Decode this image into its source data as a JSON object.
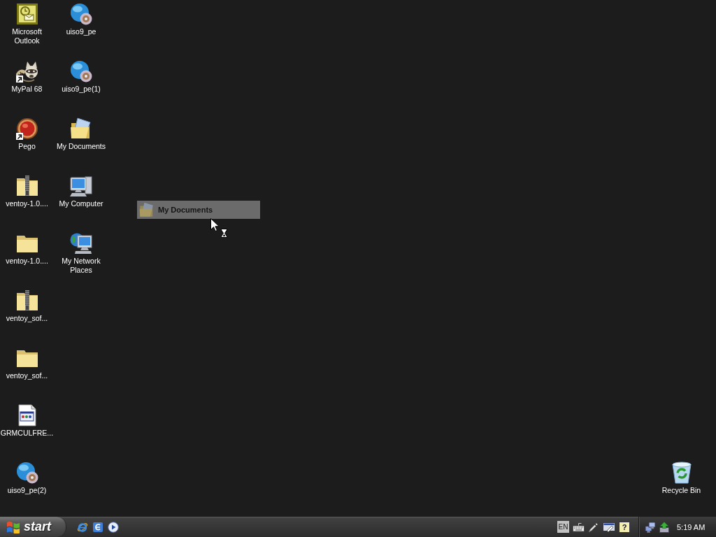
{
  "desktop": {
    "icons": [
      {
        "label": "Microsoft Outlook",
        "kind": "mail-app",
        "shortcut": false
      },
      {
        "label": "MyPal 68",
        "kind": "mascot-app",
        "shortcut": true
      },
      {
        "label": "Pego",
        "kind": "ball-app",
        "shortcut": true
      },
      {
        "label": "ventoy-1.0....",
        "kind": "zip-folder",
        "shortcut": false
      },
      {
        "label": "ventoy-1.0....",
        "kind": "folder",
        "shortcut": false
      },
      {
        "label": "ventoy_sof...",
        "kind": "zip-folder",
        "shortcut": false
      },
      {
        "label": "ventoy_sof...",
        "kind": "folder",
        "shortcut": false
      },
      {
        "label": "GRMCULFRE...",
        "kind": "document",
        "shortcut": false
      },
      {
        "label": "uiso9_pe(2)",
        "kind": "globe-disc",
        "shortcut": false
      },
      {
        "label": "uiso9_pe",
        "kind": "globe-disc",
        "shortcut": false
      },
      {
        "label": "uiso9_pe(1)",
        "kind": "globe-disc",
        "shortcut": false
      },
      {
        "label": "My Documents",
        "kind": "documents-folder",
        "shortcut": false
      },
      {
        "label": "My Computer",
        "kind": "computer",
        "shortcut": false
      },
      {
        "label": "My Network Places",
        "kind": "network",
        "shortcut": false
      }
    ],
    "corner_icons": [
      {
        "label": "Recycle Bin",
        "kind": "recycle-bin",
        "shortcut": false
      }
    ]
  },
  "drag_ghost": {
    "label": "My Documents"
  },
  "taskbar": {
    "start_button": {
      "label": "start"
    },
    "tray": {
      "language": "EN",
      "help_glyph": "?",
      "clock": "5:19 AM"
    }
  }
}
